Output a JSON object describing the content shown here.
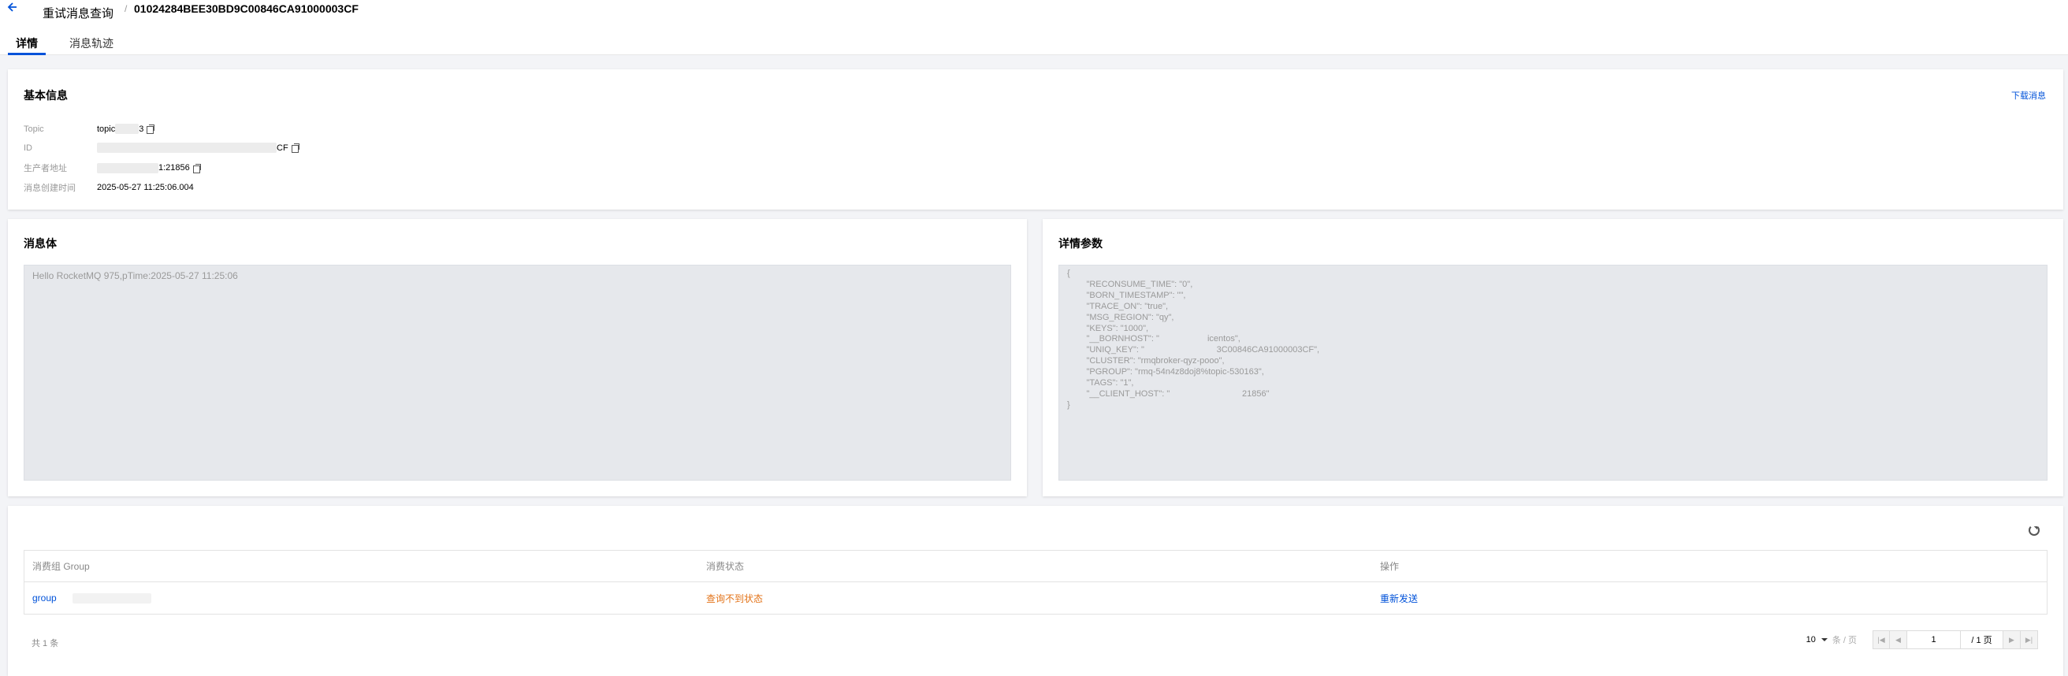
{
  "header": {
    "back_icon": "arrow-left-icon",
    "breadcrumb_parent": "重试消息查询",
    "breadcrumb_separator": "/",
    "breadcrumb_current": "01024284BEE30BD9C00846CA91000003CF"
  },
  "tabs": [
    {
      "label": "详情",
      "active": true
    },
    {
      "label": "消息轨迹",
      "active": false
    }
  ],
  "basic_info": {
    "title": "基本信息",
    "download_label": "下载消息",
    "fields": [
      {
        "label": "Topic",
        "value_prefix": "topic",
        "value_suffix": "3"
      },
      {
        "label": "ID",
        "value_prefix": "",
        "value_suffix": "CF"
      },
      {
        "label": "生产者地址",
        "value_prefix": "",
        "value_suffix": "1:21856"
      },
      {
        "label": "消息创建时间",
        "value": "2025-05-27 11:25:06.004"
      }
    ]
  },
  "message_body": {
    "title": "消息体",
    "content": "Hello RocketMQ 975,pTime:2025-05-27 11:25:06"
  },
  "detail_params": {
    "title": "详情参数",
    "content": "{\n        \"RECONSUME_TIME\": \"0\",\n        \"BORN_TIMESTAMP\": \"\",\n        \"TRACE_ON\": \"true\",\n        \"MSG_REGION\": \"qy\",\n        \"KEYS\": \"1000\",\n        \"__BORNHOST\": \"                    icentos\",\n        \"UNIQ_KEY\": \"                              3C00846CA91000003CF\",\n        \"CLUSTER\": \"rmqbroker-qyz-pooo\",\n        \"PGROUP\": \"rmq-54n4z8doj8%topic-530163\",\n        \"TAGS\": \"1\",\n        \"__CLIENT_HOST\": \"                              21856\"\n}"
  },
  "consumer_table": {
    "refresh_icon": "refresh-icon",
    "columns": [
      "消费组 Group",
      "消费状态",
      "操作"
    ],
    "rows": [
      {
        "group": "group",
        "status": "查询不到状态",
        "action": "重新发送"
      }
    ],
    "total_text": "共 1 条"
  },
  "pagination": {
    "page_size": "10",
    "page_size_unit": "条 / 页",
    "current_page": "1",
    "total_pages": "/ 1 页",
    "first_icon": "first-page-icon",
    "prev_icon": "prev-page-icon",
    "next_icon": "next-page-icon",
    "last_icon": "last-page-icon"
  },
  "colors": {
    "accent": "#0052d9",
    "warning": "#e37318",
    "background": "#f3f4f7",
    "code_background": "#e6e8ec"
  }
}
